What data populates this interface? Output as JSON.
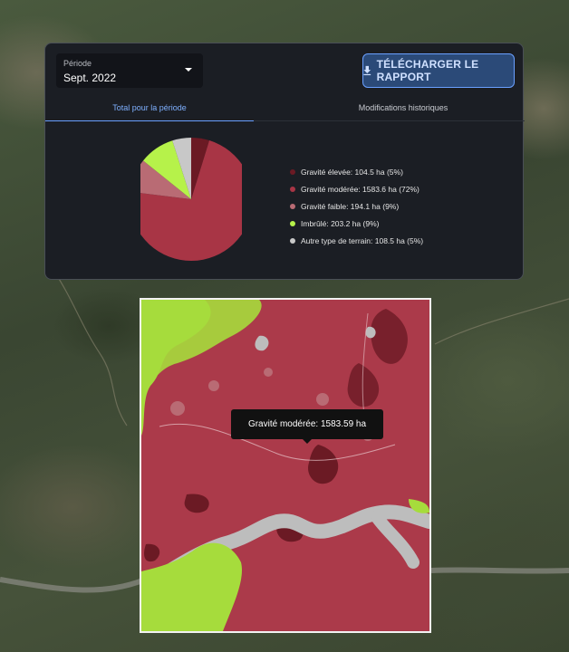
{
  "period": {
    "label": "Période",
    "value": "Sept. 2022"
  },
  "download_button": {
    "label": "TÉLÉCHARGER LE RAPPORT"
  },
  "tabs": [
    {
      "label": "Total pour la période",
      "active": true
    },
    {
      "label": "Modifications historiques",
      "active": false
    }
  ],
  "chart_data": {
    "type": "pie",
    "unit": "ha",
    "slices": [
      {
        "label": "Gravité élevée: 104.5 ha (5%)",
        "value": 104.5,
        "color": "#6b1a24"
      },
      {
        "label": "Gravité modérée: 1583.6 ha (72%)",
        "value": 1583.6,
        "color": "#a83545"
      },
      {
        "label": "Gravité faible: 194.1 ha (9%)",
        "value": 194.1,
        "color": "#b96b74"
      },
      {
        "label": "Imbrûlé: 203.2 ha (9%)",
        "value": 203.2,
        "color": "#b6f24a"
      },
      {
        "label": "Autre type de terrain: 108.5 ha (5%)",
        "value": 108.5,
        "color": "#c8c8c8"
      }
    ]
  },
  "map": {
    "tooltip": "Gravité modérée: 1583.59 ha",
    "colors": {
      "moderate": "#ab3a4a",
      "high": "#6b1a24",
      "low": "#b96b74",
      "unburned": "#a6dc3c",
      "other": "#bdbdbd"
    }
  },
  "icons": {
    "download": "download-icon",
    "dropdown": "chevron-down-icon"
  }
}
